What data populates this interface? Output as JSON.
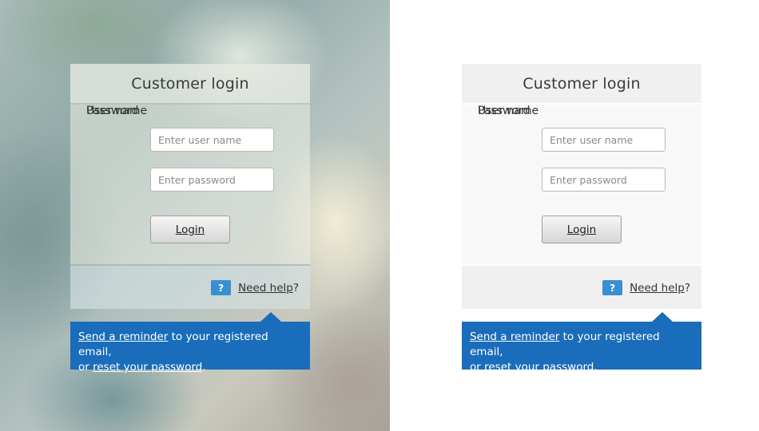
{
  "login": {
    "title": "Customer login",
    "username_label": "User name",
    "username_placeholder": "Enter user name",
    "password_label": "Password",
    "password_placeholder": "Enter password",
    "login_button": "Login",
    "help_icon_glyph": "?",
    "help_link": "Need help",
    "help_suffix": "?",
    "reminder_link": "Send a reminder",
    "reminder_text": " to your registered email,",
    "reminder_line2_prefix": "or ",
    "reset_link": "reset your password",
    "reminder_line2_suffix": "."
  },
  "colors": {
    "accent_blue": "#1a6dba",
    "help_icon_blue": "#3a8fd1"
  }
}
